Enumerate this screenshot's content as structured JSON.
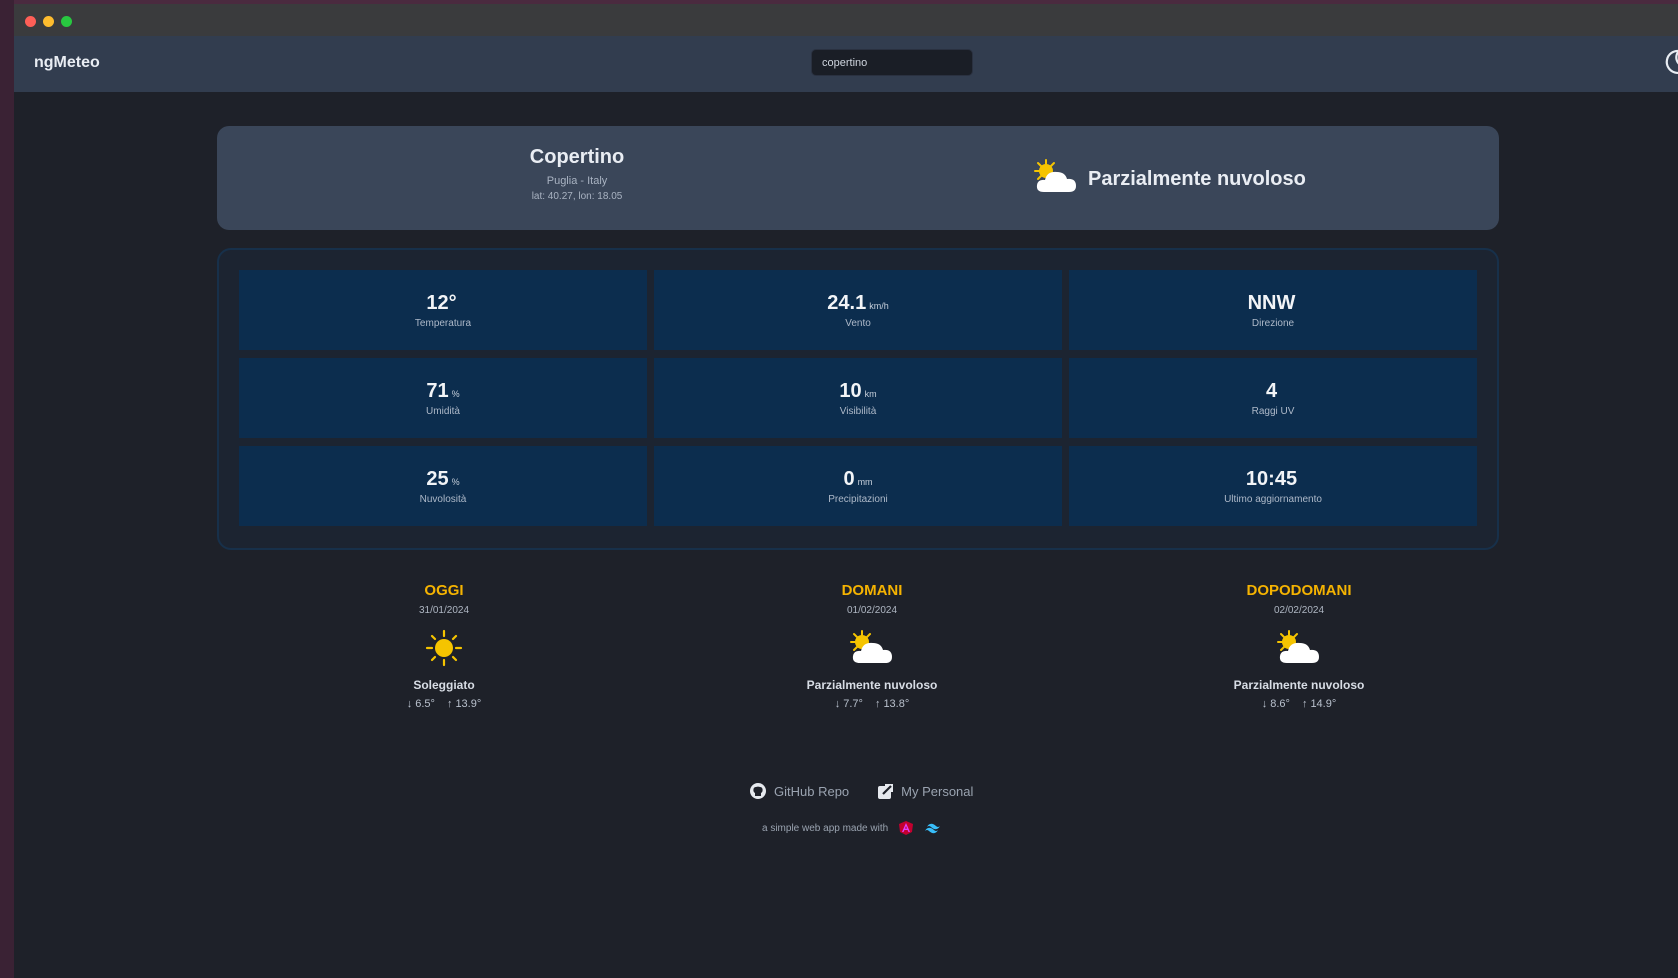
{
  "app": {
    "brand": "ngMeteo"
  },
  "search": {
    "value": "copertino"
  },
  "location": {
    "city": "Copertino",
    "region": "Puglia - Italy",
    "coords": "lat: 40.27, lon: 18.05",
    "condition": "Parzialmente nuvoloso",
    "condition_icon": "partly-cloudy-icon"
  },
  "stats": [
    {
      "value": "12°",
      "unit": "",
      "label": "Temperatura"
    },
    {
      "value": "24.1",
      "unit": "km/h",
      "label": "Vento"
    },
    {
      "value": "NNW",
      "unit": "",
      "label": "Direzione"
    },
    {
      "value": "71",
      "unit": "%",
      "label": "Umidità"
    },
    {
      "value": "10",
      "unit": "km",
      "label": "Visibilità"
    },
    {
      "value": "4",
      "unit": "",
      "label": "Raggi UV"
    },
    {
      "value": "25",
      "unit": "%",
      "label": "Nuvolosità"
    },
    {
      "value": "0",
      "unit": "mm",
      "label": "Precipitazioni"
    },
    {
      "value": "10:45",
      "unit": "",
      "label": "Ultimo aggiornamento"
    }
  ],
  "forecast": [
    {
      "title": "OGGI",
      "date": "31/01/2024",
      "icon": "sun-icon",
      "condition": "Soleggiato",
      "min": "6.5°",
      "max": "13.9°"
    },
    {
      "title": "DOMANI",
      "date": "01/02/2024",
      "icon": "partly-cloudy-icon",
      "condition": "Parzialmente nuvoloso",
      "min": "7.7°",
      "max": "13.8°"
    },
    {
      "title": "DOPODOMANI",
      "date": "02/02/2024",
      "icon": "partly-cloudy-icon",
      "condition": "Parzialmente nuvoloso",
      "min": "8.6°",
      "max": "14.9°"
    }
  ],
  "footer": {
    "github_label": "GitHub Repo",
    "personal_label": "My Personal",
    "made_with": "a simple web app made with"
  },
  "colors": {
    "accent": "#f5b301",
    "stat_tile": "#0c2d4e",
    "card": "#3a4659",
    "navbar": "#323d4f",
    "background": "#1e2129"
  }
}
